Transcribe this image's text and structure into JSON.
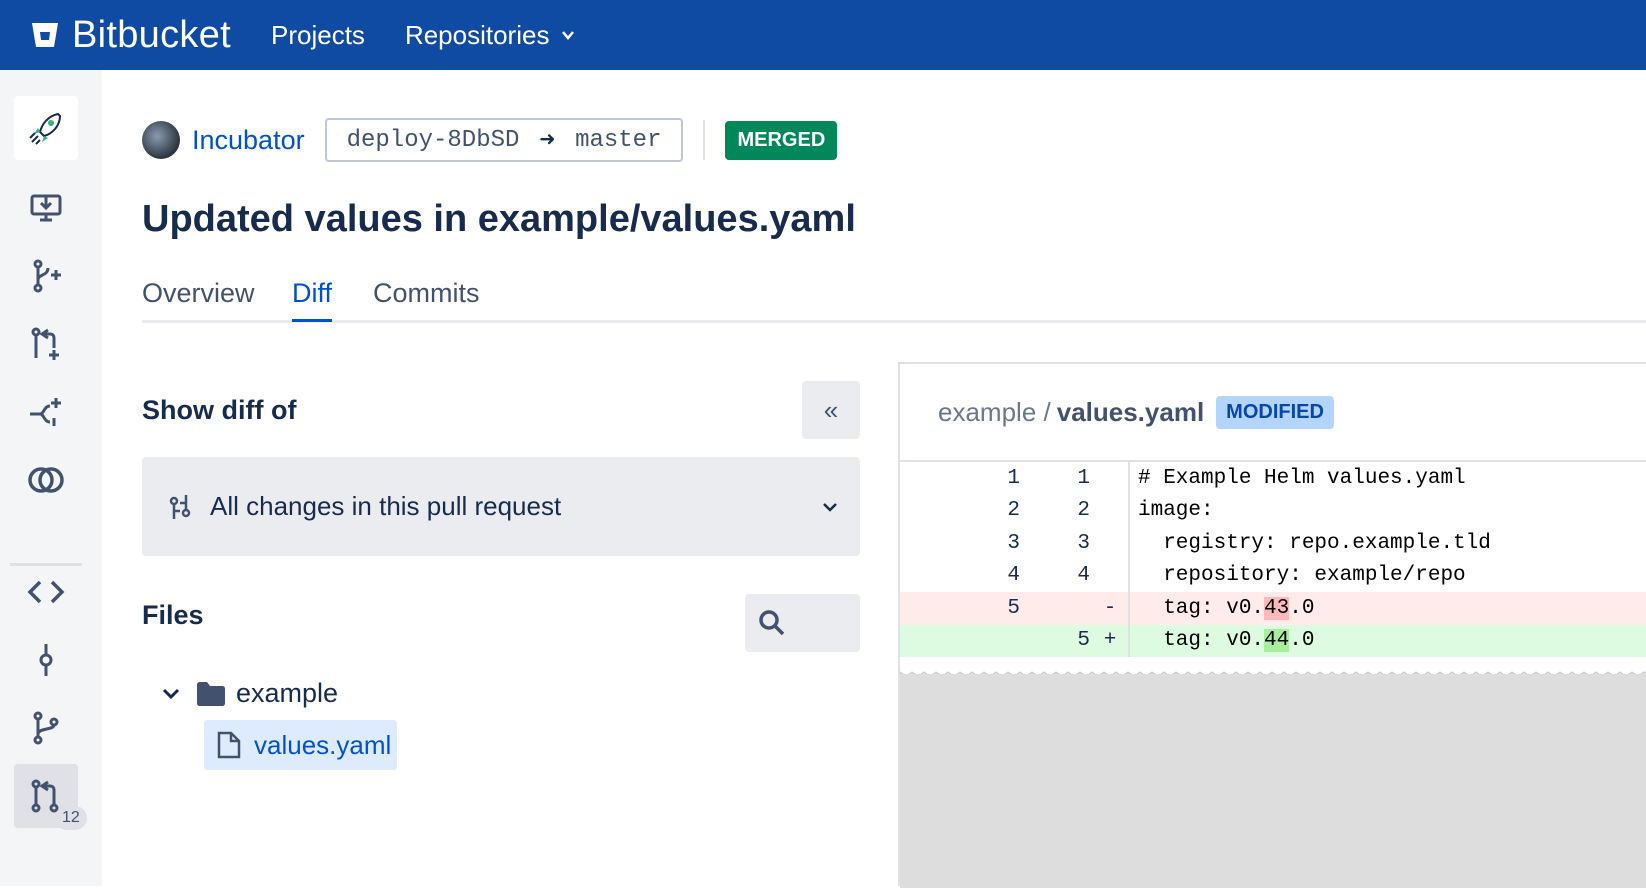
{
  "topbar": {
    "app_name": "Bitbucket",
    "nav": [
      {
        "label": "Projects"
      },
      {
        "label": "Repositories"
      }
    ]
  },
  "sidebar": {
    "pull_request_count": "12"
  },
  "pr": {
    "repo_name": "Incubator",
    "source_branch": "deploy-8DbSD",
    "target_branch": "master",
    "state": "MERGED",
    "title": "Updated values in example/values.yaml"
  },
  "tabs": [
    {
      "label": "Overview"
    },
    {
      "label": "Diff",
      "active": true
    },
    {
      "label": "Commits"
    }
  ],
  "diff_sidebar": {
    "show_diff_of_label": "Show diff of",
    "dropdown_value": "All changes in this pull request",
    "files_label": "Files",
    "tree": {
      "folder": "example",
      "file": "values.yaml"
    }
  },
  "diff": {
    "dir": "example /",
    "file": "values.yaml",
    "status": "MODIFIED",
    "lines": [
      {
        "old": "1",
        "new": "1",
        "marker": "",
        "code": "# Example Helm values.yaml",
        "type": "context"
      },
      {
        "old": "2",
        "new": "2",
        "marker": "",
        "code": "image:",
        "type": "context"
      },
      {
        "old": "3",
        "new": "3",
        "marker": "",
        "code": "  registry: repo.example.tld",
        "type": "context"
      },
      {
        "old": "4",
        "new": "4",
        "marker": "",
        "code": "  repository: example/repo",
        "type": "context"
      },
      {
        "old": "5",
        "new": "",
        "marker": "-",
        "code_pre": "  tag: v0.",
        "code_hl": "43",
        "code_post": ".0",
        "type": "del"
      },
      {
        "old": "",
        "new": "5",
        "marker": "+",
        "code_pre": "  tag: v0.",
        "code_hl": "44",
        "code_post": ".0",
        "type": "add"
      }
    ]
  },
  "colors": {
    "topbar": "#0f4ba2",
    "merged": "#00875a",
    "link": "#0052cc",
    "deleted_line": "#ffebe9",
    "added_line": "#ddfbe0"
  }
}
